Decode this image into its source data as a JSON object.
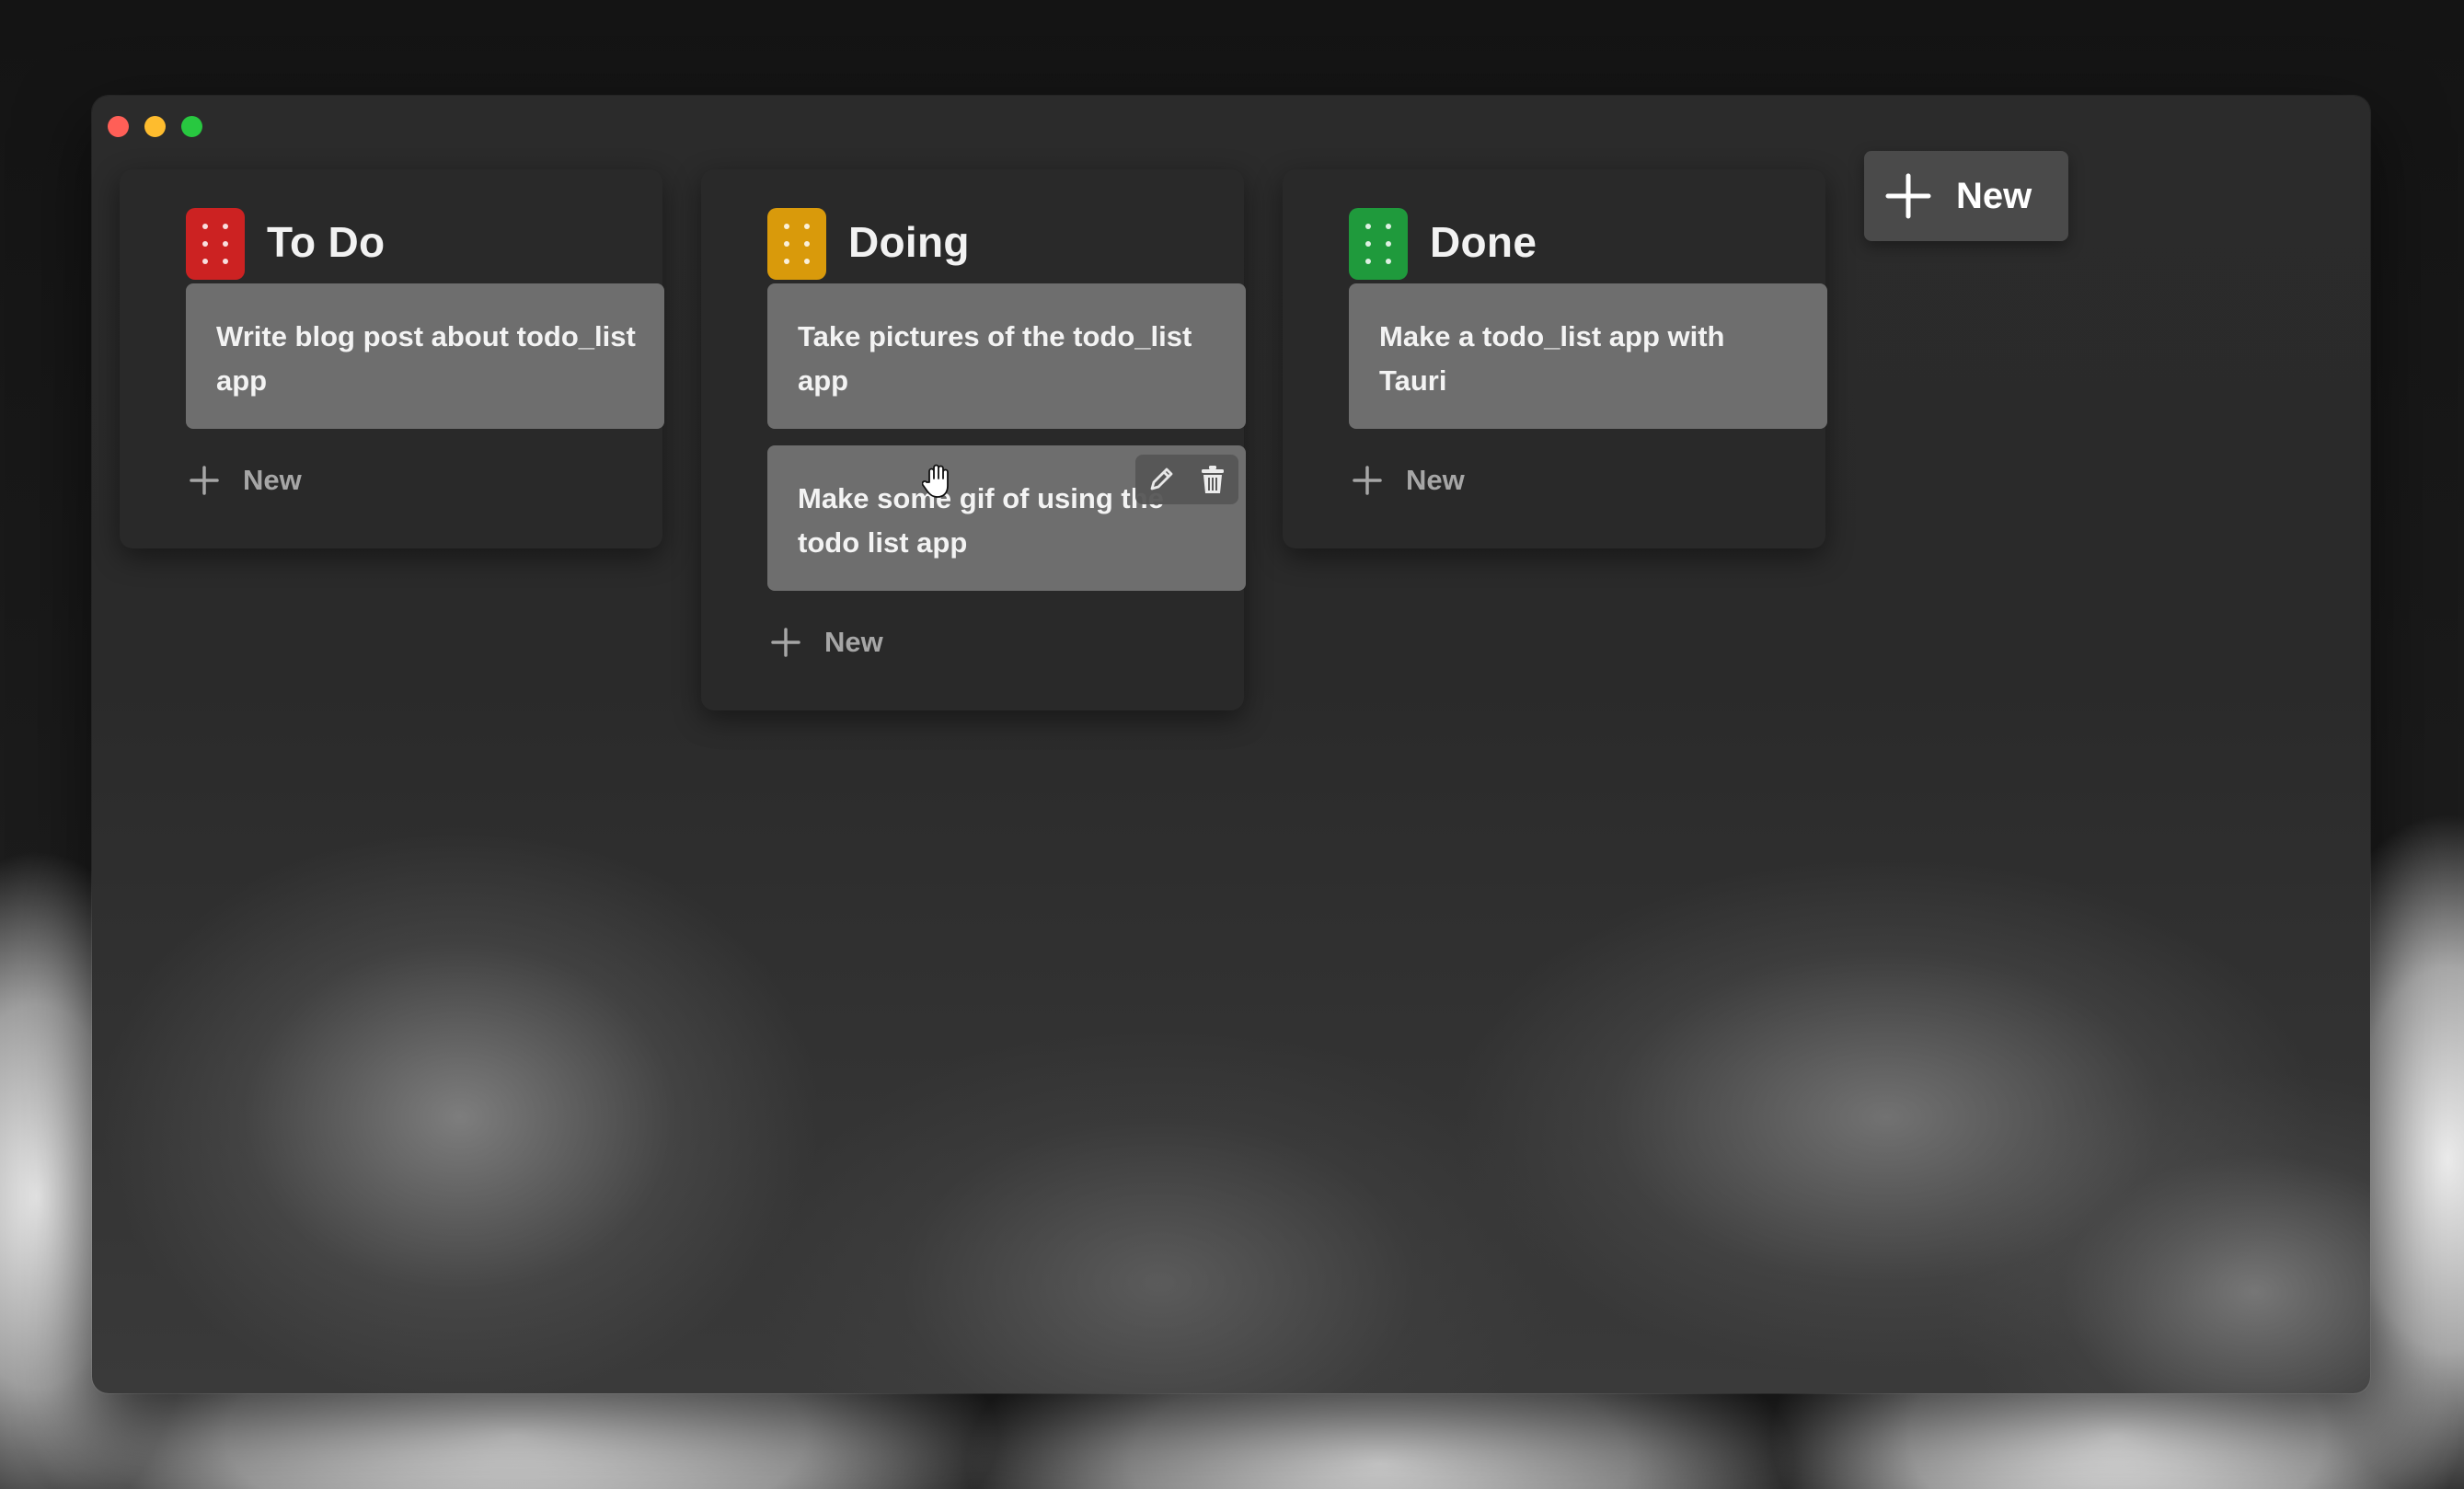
{
  "window": {
    "traffic_lights": [
      "close",
      "minimize",
      "maximize"
    ]
  },
  "columns": [
    {
      "title": "To Do",
      "color": "#cc2222",
      "cards": [
        {
          "text": "Write blog post about todo_list app"
        }
      ],
      "new_label": "New"
    },
    {
      "title": "Doing",
      "color": "#d99a0b",
      "cards": [
        {
          "text": "Take pictures of the todo_list app"
        },
        {
          "text": "Make some gif of using the todo list app",
          "hovered": true,
          "tools": [
            "pencil-icon",
            "trash-icon"
          ]
        }
      ],
      "new_label": "New"
    },
    {
      "title": "Done",
      "color": "#1f9a3c",
      "cards": [
        {
          "text": "Make a todo_list app with Tauri"
        }
      ],
      "new_label": "New"
    }
  ],
  "add_column": {
    "label": "New",
    "icon": "plus-icon"
  },
  "cursor": {
    "icon": "grab-hand-icon"
  }
}
